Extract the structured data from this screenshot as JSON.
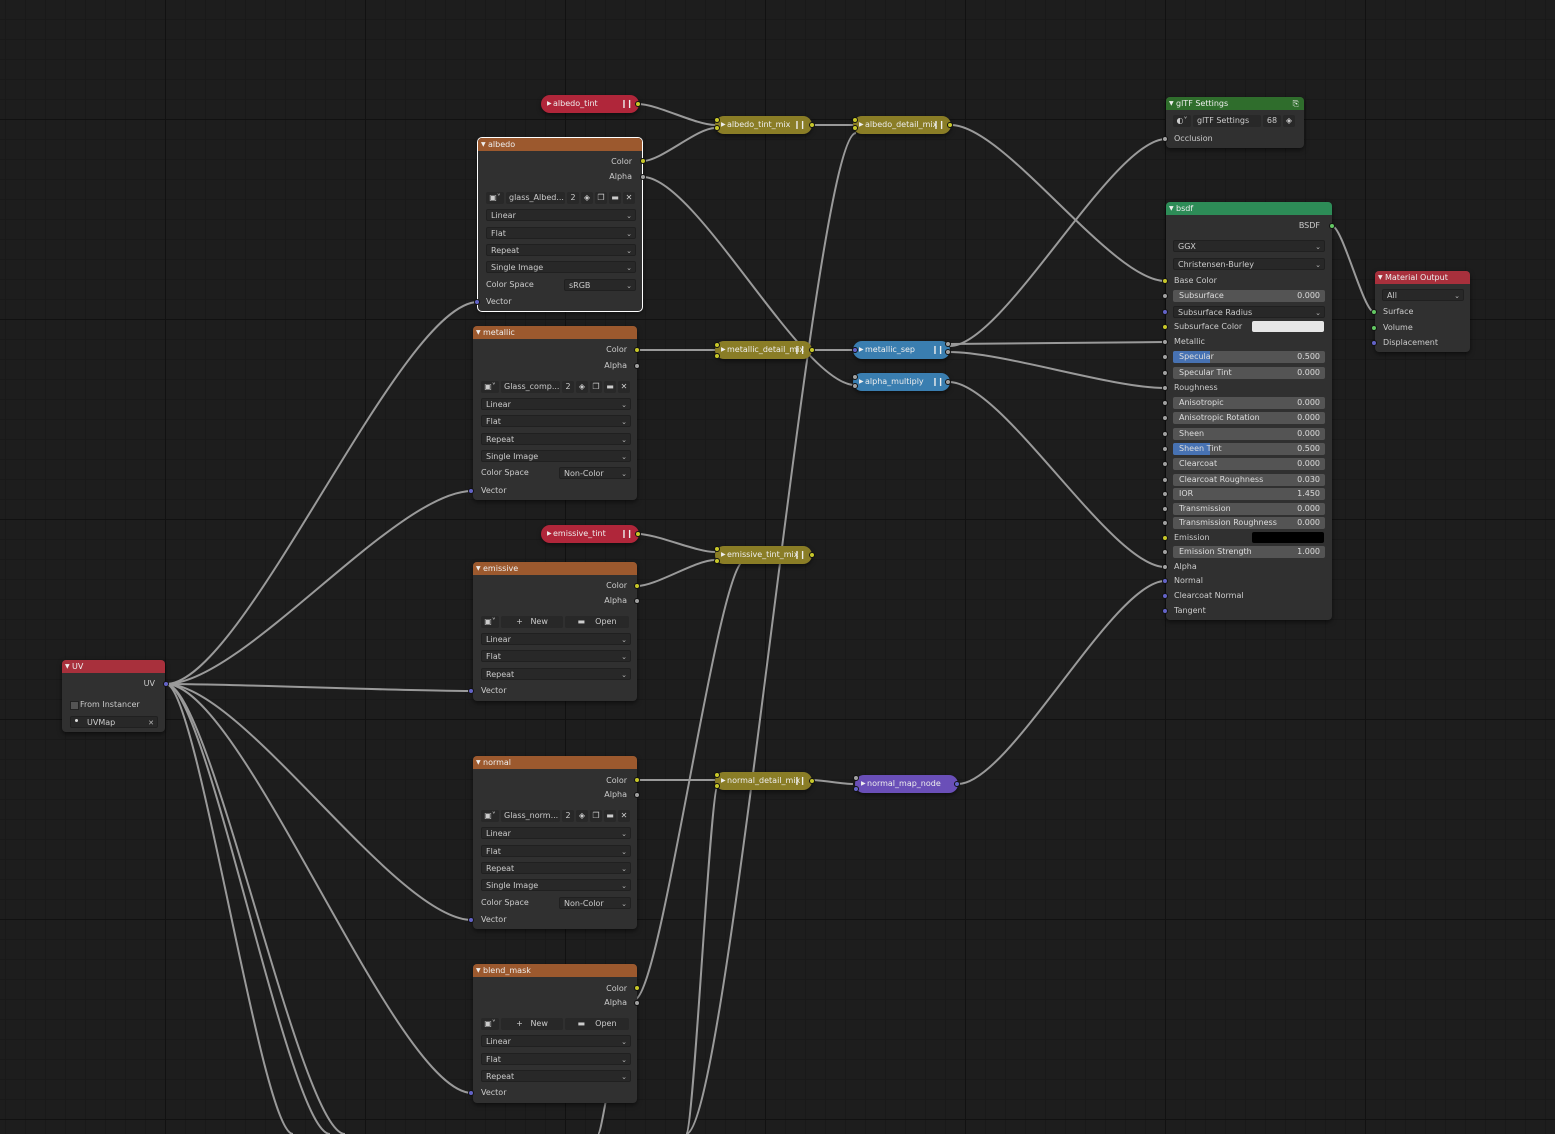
{
  "nodes": {
    "albedo_tint": {
      "label": "albedo_tint"
    },
    "albedo_tint_mix": {
      "label": "albedo_tint_mix"
    },
    "albedo_detail_mix": {
      "label": "albedo_detail_mix"
    },
    "metallic_detail_mix": {
      "label": "metallic_detail_mix"
    },
    "metallic_sep": {
      "label": "metallic_sep"
    },
    "alpha_multiply": {
      "label": "alpha_multiply"
    },
    "emissive_tint": {
      "label": "emissive_tint"
    },
    "emissive_tint_mix": {
      "label": "emissive_tint_mix"
    },
    "normal_detail_mix": {
      "label": "normal_detail_mix"
    },
    "normal_map_node": {
      "label": "normal_map_node"
    },
    "albedo": {
      "title": "albedo",
      "out_color": "Color",
      "out_alpha": "Alpha",
      "image": "glass_Albed...",
      "users": "2",
      "interpolation": "Linear",
      "projection": "Flat",
      "extension": "Repeat",
      "source": "Single Image",
      "color_space_label": "Color Space",
      "color_space": "sRGB",
      "in_vector": "Vector"
    },
    "metallic": {
      "title": "metallic",
      "out_color": "Color",
      "out_alpha": "Alpha",
      "image": "Glass_comp...",
      "users": "2",
      "interpolation": "Linear",
      "projection": "Flat",
      "extension": "Repeat",
      "source": "Single Image",
      "color_space_label": "Color Space",
      "color_space": "Non-Color",
      "in_vector": "Vector"
    },
    "emissive": {
      "title": "emissive",
      "out_color": "Color",
      "out_alpha": "Alpha",
      "new_label": "New",
      "open_label": "Open",
      "interpolation": "Linear",
      "projection": "Flat",
      "extension": "Repeat",
      "in_vector": "Vector"
    },
    "normal": {
      "title": "normal",
      "out_color": "Color",
      "out_alpha": "Alpha",
      "image": "Glass_norm...",
      "users": "2",
      "interpolation": "Linear",
      "projection": "Flat",
      "extension": "Repeat",
      "source": "Single Image",
      "color_space_label": "Color Space",
      "color_space": "Non-Color",
      "in_vector": "Vector"
    },
    "blend_mask": {
      "title": "blend_mask",
      "out_color": "Color",
      "out_alpha": "Alpha",
      "new_label": "New",
      "open_label": "Open",
      "interpolation": "Linear",
      "projection": "Flat",
      "extension": "Repeat",
      "in_vector": "Vector"
    },
    "uv": {
      "title": "UV",
      "out_uv": "UV",
      "from_instancer": "From Instancer",
      "uvmap": "UVMap"
    },
    "gltf": {
      "title": "glTF Settings",
      "group_name": "glTF Settings",
      "users": "68",
      "in_occlusion": "Occlusion"
    },
    "bsdf": {
      "title": "bsdf",
      "out_bsdf": "BSDF",
      "distribution": "GGX",
      "subsurface_method": "Christensen-Burley",
      "base_color": "Base Color",
      "subsurface": {
        "label": "Subsurface",
        "value": "0.000"
      },
      "subsurface_radius": "Subsurface Radius",
      "subsurface_color": "Subsurface Color",
      "metallic": "Metallic",
      "specular": {
        "label": "Specular",
        "value": "0.500",
        "fraction": 0.5
      },
      "specular_tint": {
        "label": "Specular Tint",
        "value": "0.000"
      },
      "roughness": "Roughness",
      "anisotropic": {
        "label": "Anisotropic",
        "value": "0.000"
      },
      "anisotropic_rotation": {
        "label": "Anisotropic Rotation",
        "value": "0.000"
      },
      "sheen": {
        "label": "Sheen",
        "value": "0.000"
      },
      "sheen_tint": {
        "label": "Sheen Tint",
        "value": "0.500",
        "fraction": 0.5
      },
      "clearcoat": {
        "label": "Clearcoat",
        "value": "0.000"
      },
      "clearcoat_roughness": {
        "label": "Clearcoat Roughness",
        "value": "0.030"
      },
      "ior": {
        "label": "IOR",
        "value": "1.450"
      },
      "transmission": {
        "label": "Transmission",
        "value": "0.000"
      },
      "transmission_roughness": {
        "label": "Transmission Roughness",
        "value": "0.000"
      },
      "emission": "Emission",
      "emission_strength": {
        "label": "Emission Strength",
        "value": "1.000"
      },
      "alpha": "Alpha",
      "normal": "Normal",
      "clearcoat_normal": "Clearcoat Normal",
      "tangent": "Tangent"
    },
    "material_output": {
      "title": "Material Output",
      "target": "All",
      "surface": "Surface",
      "volume": "Volume",
      "displacement": "Displacement"
    }
  },
  "colors": {
    "socket_color": "#c7c729",
    "socket_float": "#a1a1a1",
    "socket_vector": "#6363c7",
    "socket_shader": "#63c763",
    "texture_header": "#9c592e",
    "shader_header": "#2d8c57",
    "output_header": "#a8303c"
  },
  "icons": [
    "image-icon",
    "shield-icon",
    "duplicate-icon",
    "folder-icon",
    "close-icon",
    "plus-icon",
    "node-tree-icon",
    "pin-icon",
    "chevron-down-icon",
    "pause-icon",
    "collapse-triangle-icon"
  ]
}
